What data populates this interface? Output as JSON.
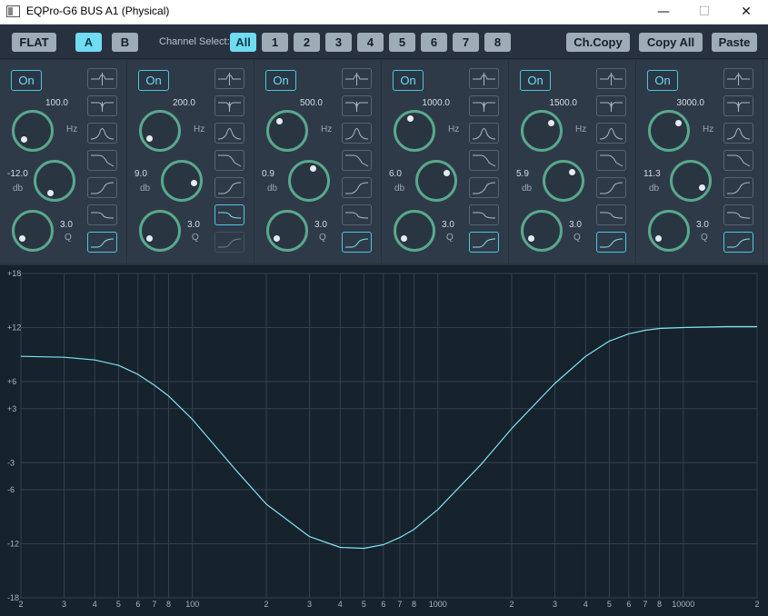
{
  "window": {
    "title": "EQPro-G6 BUS A1 (Physical)",
    "min_glyph": "—",
    "max_glyph": "☐",
    "close_glyph": "✕"
  },
  "toolbar": {
    "flat_label": "FLAT",
    "a_label": "A",
    "b_label": "B",
    "channel_select_label": "Channel Select:",
    "channels": [
      "All",
      "1",
      "2",
      "3",
      "4",
      "5",
      "6",
      "7",
      "8"
    ],
    "active_channel": "All",
    "active_preset": "A",
    "ch_copy_label": "Ch.Copy",
    "copy_all_label": "Copy All",
    "paste_label": "Paste"
  },
  "band_labels": {
    "on": "On",
    "hz": "Hz",
    "db": "db",
    "q": "Q"
  },
  "bands": [
    {
      "freq": "100.0",
      "gain": "-12.0",
      "q": "3.0",
      "selected_filter": 6,
      "disabled_filter": -1
    },
    {
      "freq": "200.0",
      "gain": "9.0",
      "q": "3.0",
      "selected_filter": 5,
      "disabled_filter": 6
    },
    {
      "freq": "500.0",
      "gain": "0.9",
      "q": "3.0",
      "selected_filter": 6,
      "disabled_filter": -1
    },
    {
      "freq": "1000.0",
      "gain": "6.0",
      "q": "3.0",
      "selected_filter": 6,
      "disabled_filter": -1
    },
    {
      "freq": "1500.0",
      "gain": "5.9",
      "q": "3.0",
      "selected_filter": 6,
      "disabled_filter": -1
    },
    {
      "freq": "3000.0",
      "gain": "11.3",
      "q": "3.0",
      "selected_filter": 6,
      "disabled_filter": -1
    }
  ],
  "filter_icons": [
    "bell-icon",
    "notch-icon",
    "bandpass-icon",
    "high-shelf-icon",
    "high-pass-icon",
    "low-shelf-icon",
    "low-pass-icon"
  ],
  "colors": {
    "accent": "#6fdcf2",
    "knob_ring": "#58a98c",
    "curve": "#7fe3f5",
    "background": "#2a3340"
  },
  "chart_data": {
    "type": "line",
    "x_scale": "log",
    "xlim": [
      20,
      20000
    ],
    "ylim": [
      -18,
      18
    ],
    "y_ticks": [
      "+18",
      "+12",
      "+6",
      "+3",
      "-3",
      "-6",
      "-12",
      "-18"
    ],
    "y_tick_values": [
      18,
      12,
      6,
      3,
      -3,
      -6,
      -12,
      -18
    ],
    "x_tick_labels": [
      "2",
      "3",
      "4",
      "5",
      "6",
      "7",
      "8",
      "100",
      "2",
      "3",
      "4",
      "5",
      "6",
      "7",
      "8",
      "1000",
      "2",
      "3",
      "4",
      "5",
      "6",
      "7",
      "8",
      "10000",
      "2"
    ],
    "x_tick_values": [
      20,
      30,
      40,
      50,
      60,
      70,
      80,
      100,
      200,
      300,
      400,
      500,
      600,
      700,
      800,
      1000,
      2000,
      3000,
      4000,
      5000,
      6000,
      7000,
      8000,
      10000,
      20000
    ],
    "grid": true,
    "series": [
      {
        "x": [
          20,
          30,
          40,
          50,
          60,
          70,
          80,
          100,
          150,
          200,
          300,
          400,
          500,
          600,
          700,
          800,
          1000,
          1500,
          2000,
          3000,
          4000,
          5000,
          6000,
          7000,
          8000,
          10000,
          15000,
          20000
        ],
        "y": [
          8.8,
          8.7,
          8.4,
          7.8,
          6.8,
          5.6,
          4.4,
          1.8,
          -3.8,
          -7.6,
          -11.2,
          -12.4,
          -12.5,
          -12.1,
          -11.3,
          -10.4,
          -8.2,
          -3.2,
          0.8,
          5.8,
          8.8,
          10.5,
          11.3,
          11.7,
          11.9,
          12.0,
          12.1,
          12.1
        ]
      }
    ]
  }
}
